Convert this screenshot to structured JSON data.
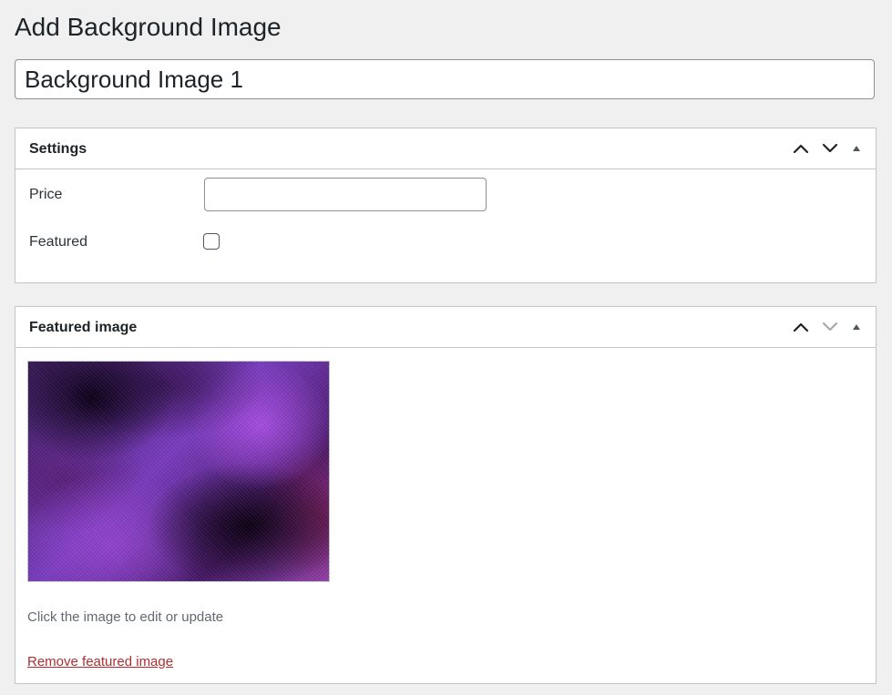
{
  "page": {
    "title": "Add Background Image"
  },
  "title_field": {
    "value": "Background Image 1"
  },
  "settings_box": {
    "title": "Settings",
    "price_label": "Price",
    "price_value": "",
    "featured_label": "Featured",
    "featured_checked": false,
    "actions": [
      "move-up-icon",
      "move-down-icon",
      "toggle-panel-icon"
    ]
  },
  "featured_image_box": {
    "title": "Featured image",
    "help_text": "Click the image to edit or update",
    "remove_link": "Remove featured image",
    "actions": [
      "move-up-icon",
      "move-down-icon",
      "toggle-panel-icon"
    ]
  },
  "colors": {
    "page_background": "#f0f0f1",
    "panel_border": "#c3c4c7",
    "text": "#1d2327",
    "muted_text": "#646970",
    "remove_link": "#b32d2e",
    "active_arrow": "#1d2327",
    "disabled_arrow": "#a7aaad"
  }
}
